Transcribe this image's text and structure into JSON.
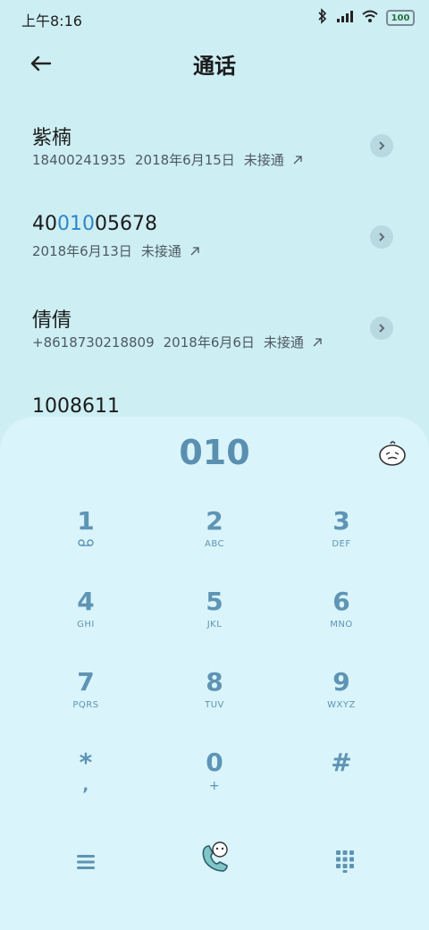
{
  "status": {
    "time": "上午8:16",
    "battery": "100"
  },
  "header": {
    "title": "通话"
  },
  "calls": [
    {
      "name": "紫楠",
      "number": "18400241935",
      "date": "2018年6月15日",
      "status": "未接通"
    },
    {
      "name_parts": [
        "40",
        "010",
        "05678"
      ],
      "date": "2018年6月13日",
      "status": "未接通"
    },
    {
      "name": "倩倩",
      "number": "+8618730218809",
      "date": "2018年6月6日",
      "status": "未接通"
    },
    {
      "name": "1008611"
    }
  ],
  "dialer": {
    "input": "010",
    "keys": [
      {
        "digit": "1",
        "sub": "voicemail"
      },
      {
        "digit": "2",
        "sub": "ABC"
      },
      {
        "digit": "3",
        "sub": "DEF"
      },
      {
        "digit": "4",
        "sub": "GHI"
      },
      {
        "digit": "5",
        "sub": "JKL"
      },
      {
        "digit": "6",
        "sub": "MNO"
      },
      {
        "digit": "7",
        "sub": "PQRS"
      },
      {
        "digit": "8",
        "sub": "TUV"
      },
      {
        "digit": "9",
        "sub": "WXYZ"
      },
      {
        "digit": "*",
        "sub": ","
      },
      {
        "digit": "0",
        "sub": "+"
      },
      {
        "digit": "#",
        "sub": ""
      }
    ]
  }
}
